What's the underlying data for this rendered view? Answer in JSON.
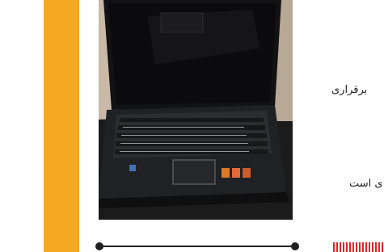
{
  "colors": {
    "accent": "#f7a823",
    "slider": "#1f1f1f",
    "dash": "#e02424"
  },
  "text": {
    "snippet_1": "برقراری",
    "snippet_2": "ی است"
  },
  "photo": {
    "subject_icon": "laptop-icon"
  }
}
